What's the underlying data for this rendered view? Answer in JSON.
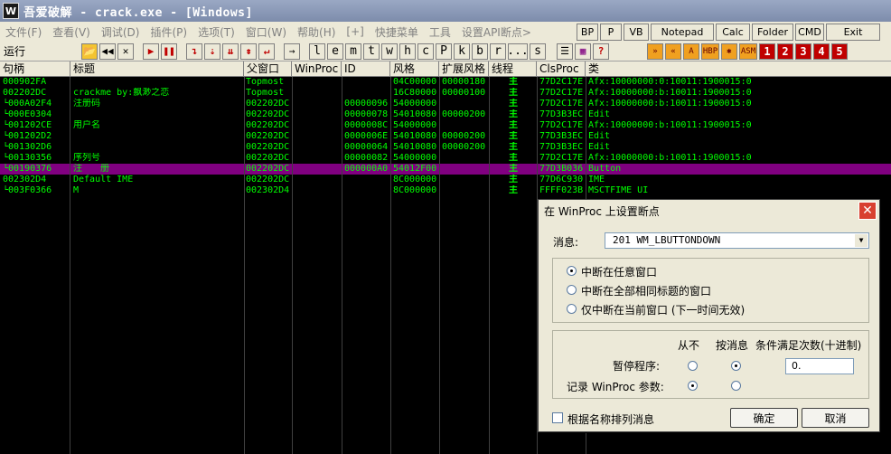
{
  "window": {
    "title": "吾爱破解 - crack.exe - [Windows]",
    "icon": "W"
  },
  "menu": {
    "items": [
      "文件(F)",
      "查看(V)",
      "调试(D)",
      "插件(P)",
      "选项(T)",
      "窗口(W)",
      "帮助(H)",
      "[+]",
      "快捷菜单",
      "工具",
      "设置API断点>"
    ],
    "right_buttons": [
      "BP",
      "P",
      "VB",
      "Notepad",
      "Calc",
      "Folder",
      "CMD",
      "Exit"
    ]
  },
  "toolbar": {
    "status": "运行",
    "letters": [
      "l",
      "e",
      "m",
      "t",
      "w",
      "h",
      "c",
      "P",
      "k",
      "b",
      "r",
      "...",
      "s"
    ],
    "plugin_labels": [
      "A",
      "HBP",
      "ASM",
      "1",
      "2",
      "3",
      "4",
      "5"
    ]
  },
  "table": {
    "columns": [
      "句柄",
      "标题",
      "父窗口",
      "WinProc",
      "ID",
      "风格",
      "扩展风格",
      "线程",
      "ClsProc",
      "类"
    ],
    "rows": [
      {
        "handle": "000902FA",
        "title": "",
        "parent": "Topmost",
        "winproc": "",
        "id": "",
        "style": "04C00000",
        "exstyle": "00000180",
        "thread": "主",
        "clsproc": "77D2C17E",
        "cls": "Afx:10000000:0:10011:1900015:0"
      },
      {
        "handle": "002202DC",
        "title": "crackme by:飘渺之恋",
        "parent": "Topmost",
        "winproc": "",
        "id": "",
        "style": "16C80000",
        "exstyle": "00000100",
        "thread": "主",
        "clsproc": "77D2C17E",
        "cls": "Afx:10000000:b:10011:1900015:0"
      },
      {
        "handle": "└000A02F4",
        "title": "注册码",
        "parent": "002202DC",
        "winproc": "",
        "id": "00000096",
        "style": "54000000",
        "exstyle": "",
        "thread": "主",
        "clsproc": "77D2C17E",
        "cls": "Afx:10000000:b:10011:1900015:0"
      },
      {
        "handle": "└000E0304",
        "title": "",
        "parent": "002202DC",
        "winproc": "",
        "id": "00000078",
        "style": "54010080",
        "exstyle": "00000200",
        "thread": "主",
        "clsproc": "77D3B3EC",
        "cls": "Edit"
      },
      {
        "handle": "└001202CE",
        "title": "用户名",
        "parent": "002202DC",
        "winproc": "",
        "id": "0000008C",
        "style": "54000000",
        "exstyle": "",
        "thread": "主",
        "clsproc": "77D2C17E",
        "cls": "Afx:10000000:b:10011:1900015:0"
      },
      {
        "handle": "└001202D2",
        "title": "",
        "parent": "002202DC",
        "winproc": "",
        "id": "0000006E",
        "style": "54010080",
        "exstyle": "00000200",
        "thread": "主",
        "clsproc": "77D3B3EC",
        "cls": "Edit"
      },
      {
        "handle": "└001302D6",
        "title": "",
        "parent": "002202DC",
        "winproc": "",
        "id": "00000064",
        "style": "54010080",
        "exstyle": "00000200",
        "thread": "主",
        "clsproc": "77D3B3EC",
        "cls": "Edit"
      },
      {
        "handle": "└00130356",
        "title": "序列号",
        "parent": "002202DC",
        "winproc": "",
        "id": "00000082",
        "style": "54000000",
        "exstyle": "",
        "thread": "主",
        "clsproc": "77D2C17E",
        "cls": "Afx:10000000:b:10011:1900015:0"
      },
      {
        "handle": "└00190376",
        "title": "注　　册",
        "parent": "002202DC",
        "winproc": "",
        "id": "000000A0",
        "style": "54012F00",
        "exstyle": "",
        "thread": "主",
        "clsproc": "77D3B036",
        "cls": "Button",
        "selected": true
      },
      {
        "handle": "002302D4",
        "title": "Default IME",
        "parent": "002202DC",
        "winproc": "",
        "id": "",
        "style": "8C000000",
        "exstyle": "",
        "thread": "主",
        "clsproc": "77D6C930",
        "cls": "IME"
      },
      {
        "handle": "└003F0366",
        "title": "M",
        "parent": "002302D4",
        "winproc": "",
        "id": "",
        "style": "8C000000",
        "exstyle": "",
        "thread": "主",
        "clsproc": "FFFF023B",
        "cls": "MSCTFIME UI"
      }
    ]
  },
  "dialog": {
    "title": "在 WinProc 上设置断点",
    "message_label": "消息:",
    "message_value": "201 WM_LBUTTONDOWN",
    "radio_options": [
      "中断在任意窗口",
      "中断在全部相同标题的窗口",
      "仅中断在当前窗口 (下一时间无效)"
    ],
    "col_never": "从不",
    "col_on_msg": "按消息",
    "col_condition": "条件满足次数(十进制)",
    "row_pause": "暂停程序:",
    "row_log": "记录 WinProc 参数:",
    "count_value": "0.",
    "sort_label": "根据名称排列消息",
    "ok": "确定",
    "cancel": "取消"
  }
}
